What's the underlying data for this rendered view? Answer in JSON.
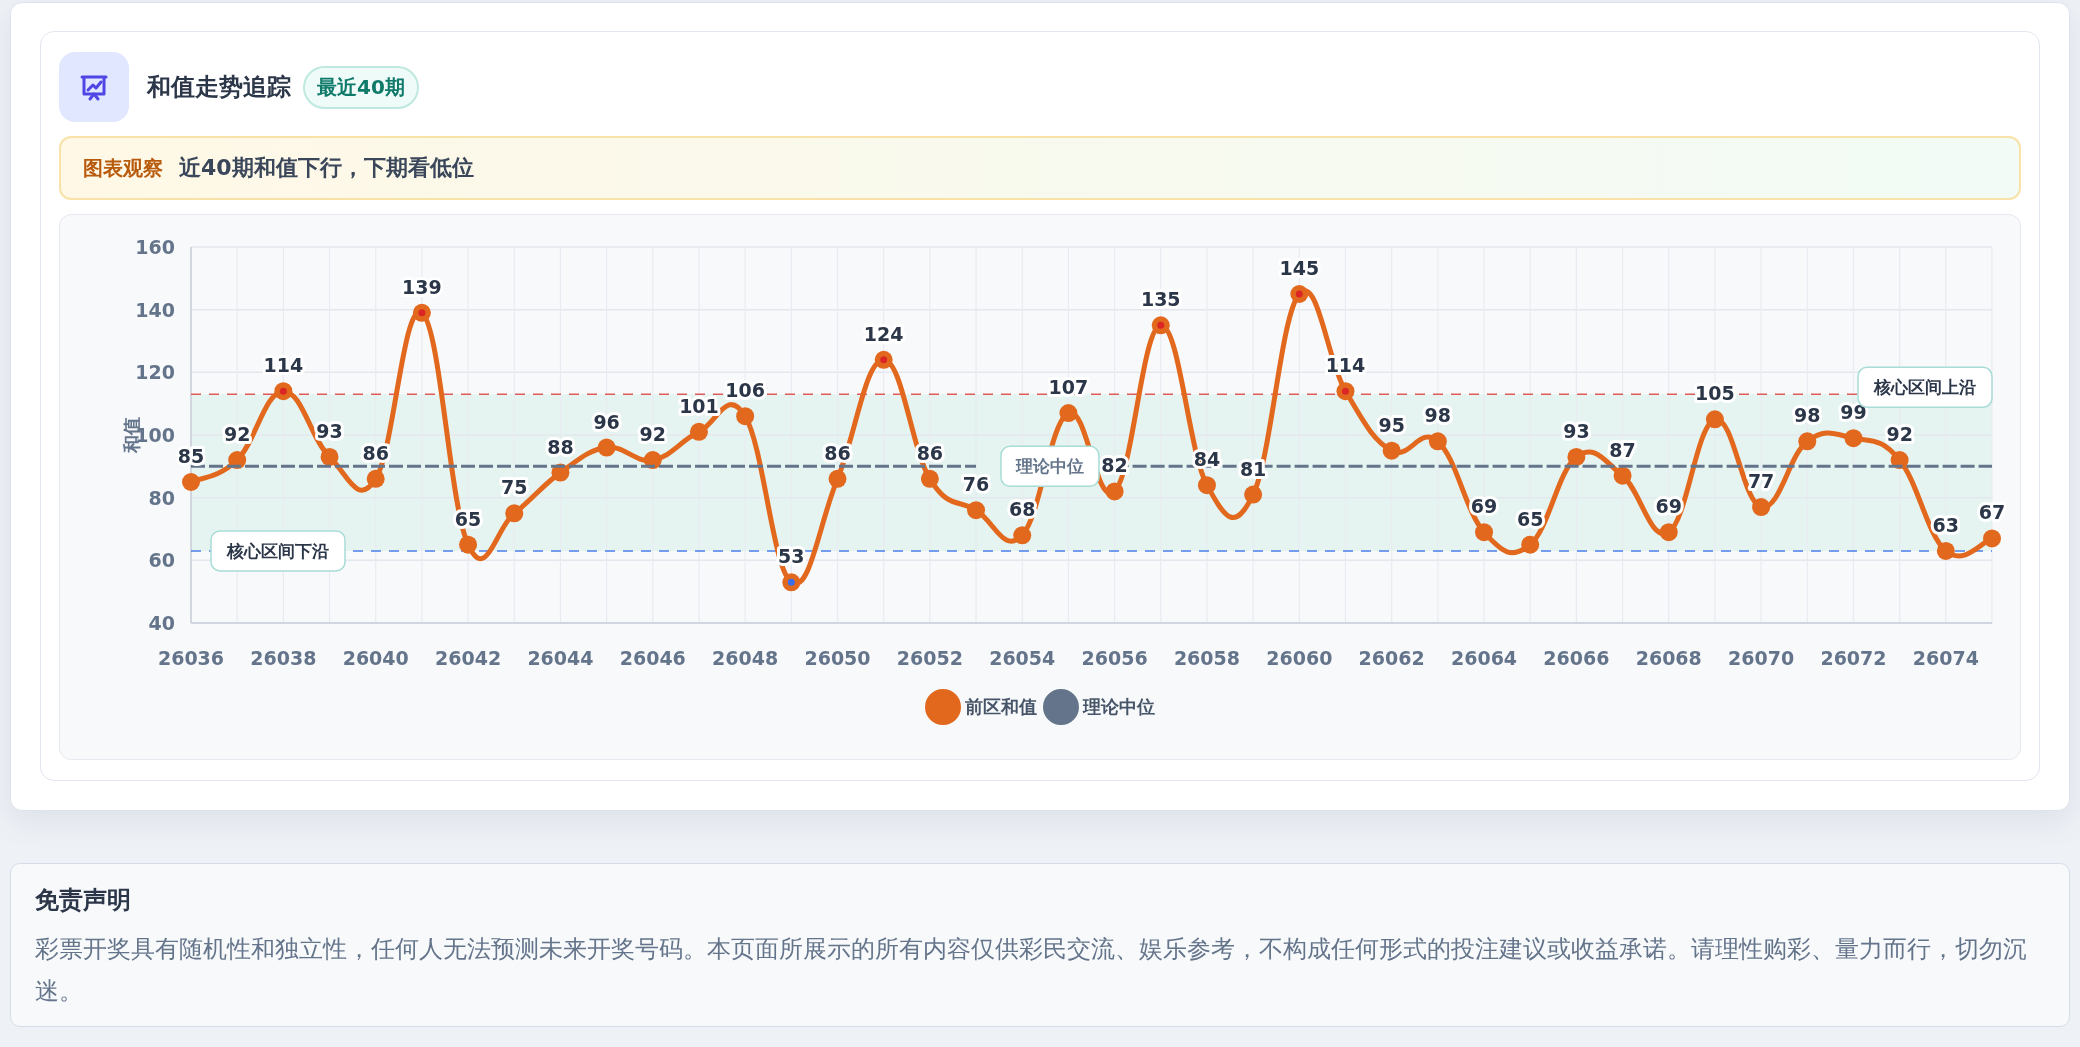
{
  "panel": {
    "title": "和值走势追踪",
    "badge": "最近40期"
  },
  "insight": {
    "label": "图表观察",
    "text": "近40期和值下行，下期看低位"
  },
  "chart": {
    "chart_data": {
      "type": "line",
      "ylabel": "和值",
      "x": [
        26036,
        26037,
        26038,
        26039,
        26040,
        26041,
        26042,
        26043,
        26044,
        26045,
        26046,
        26047,
        26048,
        26049,
        26050,
        26051,
        26052,
        26053,
        26054,
        26055,
        26056,
        26057,
        26058,
        26059,
        26060,
        26061,
        26062,
        26063,
        26064,
        26065,
        26066,
        26067,
        26068,
        26069,
        26070,
        26071,
        26072,
        26073,
        26074,
        26075
      ],
      "series": [
        {
          "name": "前区和值",
          "color": "#e2681e",
          "marker": "circle",
          "values": [
            85,
            92,
            114,
            93,
            86,
            139,
            65,
            75,
            88,
            96,
            92,
            101,
            106,
            53,
            86,
            124,
            86,
            76,
            68,
            107,
            82,
            135,
            84,
            81,
            145,
            114,
            95,
            98,
            69,
            65,
            93,
            87,
            69,
            105,
            77,
            98,
            99,
            92,
            63,
            67
          ],
          "value_labels": [
            "85",
            "92",
            "114",
            "93",
            "86",
            "139",
            "65",
            "75",
            "88",
            "96",
            "92",
            "101",
            "106",
            "53",
            "86",
            "124",
            "86",
            "76",
            "68",
            "107",
            "82",
            "135",
            "84",
            "81",
            "145",
            "114",
            "95",
            "98",
            "69",
            "65",
            "93",
            "87",
            "69",
            "105",
            "77",
            "98",
            "99",
            "92",
            "63",
            "67"
          ]
        },
        {
          "name": "理论中位",
          "color": "#64748b",
          "line_style": "dashed",
          "values": [
            90,
            90,
            90,
            90,
            90,
            90,
            90,
            90,
            90,
            90,
            90,
            90,
            90,
            90,
            90,
            90,
            90,
            90,
            null,
            null,
            90,
            90,
            90,
            90,
            90,
            90,
            90,
            90,
            90,
            90,
            90,
            90,
            90,
            90,
            90,
            90,
            90,
            90,
            90,
            90
          ]
        }
      ],
      "xlim": [
        26036,
        26075
      ],
      "ylim": [
        40,
        160
      ],
      "yticks": [
        40,
        60,
        80,
        100,
        120,
        140,
        160
      ],
      "grid": true,
      "xticks": [
        26036,
        26038,
        26040,
        26042,
        26044,
        26046,
        26048,
        26050,
        26052,
        26054,
        26056,
        26058,
        26060,
        26062,
        26064,
        26066,
        26068,
        26070,
        26072,
        26074
      ],
      "ref_lines": [
        {
          "axis": "y",
          "value": 113,
          "label": "核心区间上沿",
          "color": "#e05a5a",
          "line_style": "dashed"
        },
        {
          "axis": "y",
          "value": 63,
          "label": "核心区间下沿",
          "color": "#4a7fe8",
          "line_style": "dashed"
        }
      ],
      "bands": [
        {
          "axis": "y",
          "from": 63,
          "to": 113,
          "color": "#e5f4f0"
        }
      ]
    },
    "median_label": "理论中位"
  },
  "disclaimer": {
    "title": "免责声明",
    "text": "彩票开奖具有随机性和独立性，任何人无法预测未来开奖号码。本页面所展示的所有内容仅供彩民交流、娱乐参考，不构成任何形式的投注建议或收益承诺。请理性购彩、量力而行，切勿沉迷。"
  }
}
